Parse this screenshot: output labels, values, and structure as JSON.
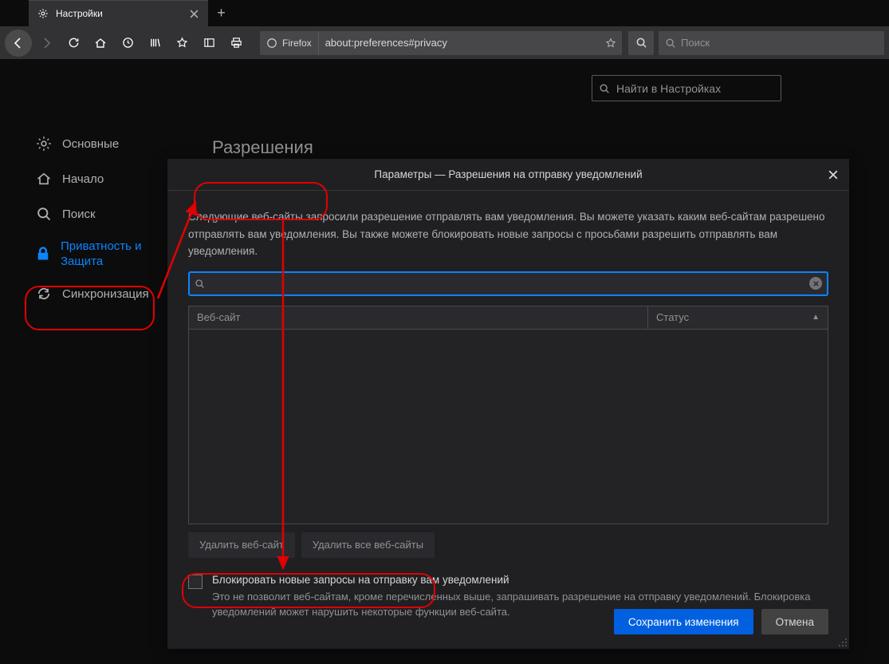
{
  "tab": {
    "title": "Настройки"
  },
  "urlbar": {
    "identity": "Firefox",
    "url": "about:preferences#privacy"
  },
  "toolbar_search": {
    "placeholder": "Поиск"
  },
  "settings_search": {
    "placeholder": "Найти в Настройках"
  },
  "sidebar": {
    "items": [
      {
        "label": "Основные"
      },
      {
        "label": "Начало"
      },
      {
        "label": "Поиск"
      },
      {
        "label": "Приватность и Защита"
      },
      {
        "label": "Синхронизация"
      }
    ]
  },
  "section": {
    "heading": "Разрешения"
  },
  "dialog": {
    "title": "Параметры — Разрешения на отправку уведомлений",
    "description": "Следующие веб-сайты запросили разрешение отправлять вам уведомления. Вы можете указать каким веб-сайтам разрешено отправлять вам уведомления. Вы также можете блокировать новые запросы с просьбами разрешить отправлять вам уведомления.",
    "columns": {
      "site": "Веб-сайт",
      "status": "Статус"
    },
    "remove_site": "Удалить веб-сайт",
    "remove_all": "Удалить все веб-сайты",
    "block_label": "Блокировать новые запросы на отправку вам уведомлений",
    "block_desc": "Это не позволит веб-сайтам, кроме перечисленных выше, запрашивать разрешение на отправку уведомлений. Блокировка уведомлений может нарушить некоторые функции веб-сайта.",
    "save": "Сохранить изменения",
    "cancel": "Отмена"
  }
}
